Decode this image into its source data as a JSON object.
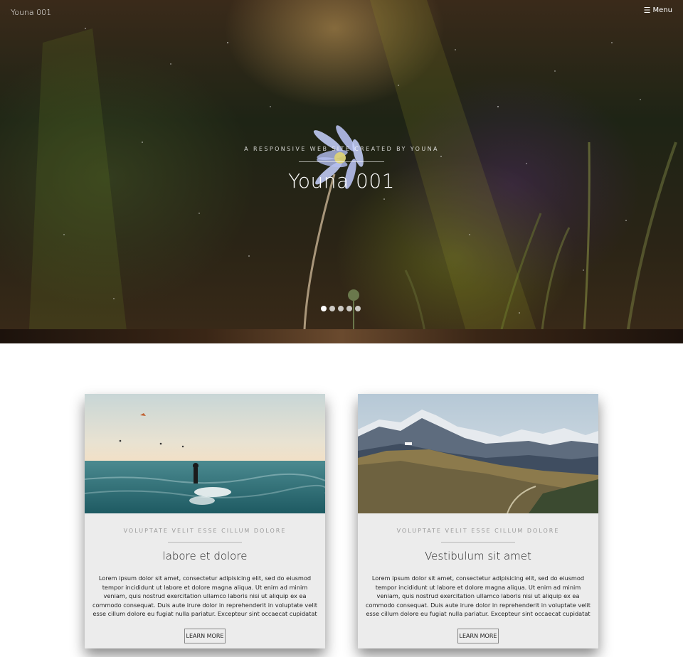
{
  "header": {
    "site_title": "Youna 001",
    "menu_icon": "hamburger-icon",
    "menu_glyph": "☰",
    "menu_label": "Menu"
  },
  "hero": {
    "subtitle": "A RESPONSIVE WEB SITE CREATED BY YOUNA",
    "title": "Youna 001",
    "slides": {
      "count": 5,
      "active": 0
    }
  },
  "cards": [
    {
      "kicker": "VOLUPTATE VELIT ESSE CILLUM DOLORE",
      "title": "labore et dolore",
      "text": "Lorem ipsum dolor sit amet, consectetur adipisicing elit, sed do eiusmod tempor incididunt ut labore et dolore magna aliqua. Ut enim ad minim veniam, quis nostrud exercitation ullamco laboris nisi ut aliquip ex ea commodo consequat. Duis aute irure dolor in reprehenderit in voluptate velit esse cillum dolore eu fugiat nulla pariatur. Excepteur sint occaecat cupidatat",
      "button": "LEARN MORE"
    },
    {
      "kicker": "VOLUPTATE VELIT ESSE CILLUM DOLORE",
      "title": "Vestibulum sit amet",
      "text": "Lorem ipsum dolor sit amet, consectetur adipisicing elit, sed do eiusmod tempor incididunt ut labore et dolore magna aliqua. Ut enim ad minim veniam, quis nostrud exercitation ullamco laboris nisi ut aliquip ex ea commodo consequat. Duis aute irure dolor in reprehenderit in voluptate velit esse cillum dolore eu fugiat nulla pariatur. Excepteur sint occaecat cupidatat",
      "button": "LEARN MORE"
    }
  ],
  "colors": {
    "card_background": "#ececec",
    "accent_text": "#9a9a9a"
  }
}
